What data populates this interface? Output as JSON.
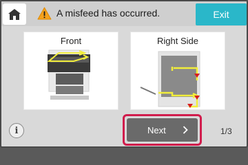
{
  "header": {
    "home_icon": "home-icon",
    "warning_icon": "warning-triangle-icon",
    "message": "A misfeed has occurred.",
    "exit_label": "Exit"
  },
  "panels": [
    {
      "label": "Front",
      "image": "printer-front-diagram"
    },
    {
      "label": "Right Side",
      "image": "printer-right-side-diagram"
    }
  ],
  "footer": {
    "info_icon": "info-icon",
    "info_label": "i",
    "next_label": "Next",
    "next_icon": "chevron-right-icon",
    "page_indicator": "1/3"
  },
  "colors": {
    "accent": "#2ab7c9",
    "highlight": "#d11c4c",
    "guide_arrow": "#f2ee3a",
    "warning": "#f4a11c",
    "jam_marker": "#d81e1e"
  }
}
